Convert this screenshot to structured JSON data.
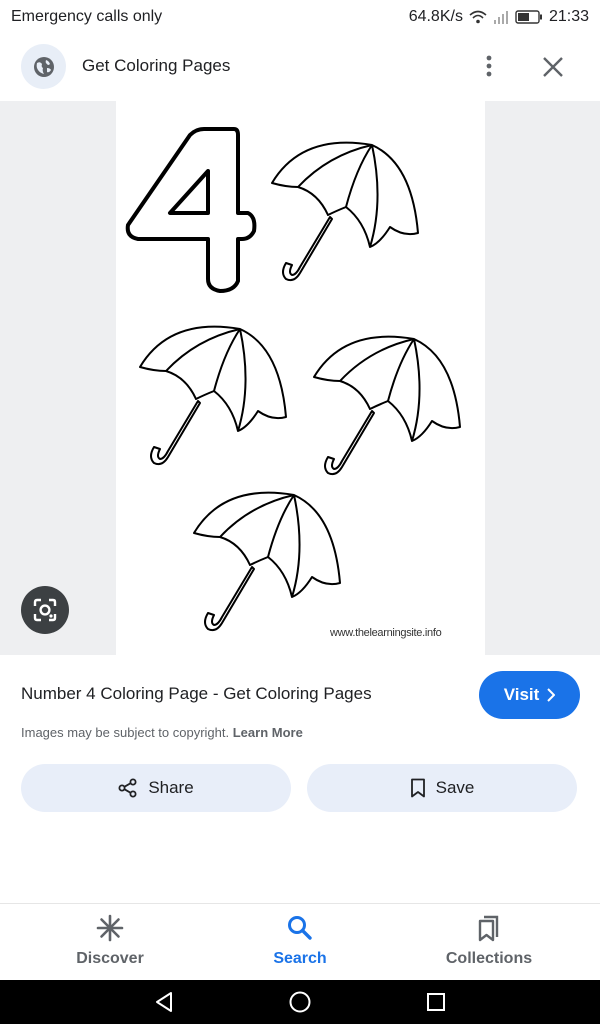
{
  "status_bar": {
    "carrier_text": "Emergency calls only",
    "network_speed": "64.8K/s",
    "time": "21:33",
    "icons": [
      "wifi-icon",
      "signal-icon",
      "battery-icon"
    ]
  },
  "top_bar": {
    "site_icon": "globe-icon",
    "title": "Get Coloring Pages",
    "menu_icon": "more-vert-icon",
    "close_icon": "close-icon"
  },
  "image": {
    "watermark": "www.thelearningsite.info",
    "lens_icon": "google-lens-icon"
  },
  "result": {
    "title": "Number 4 Coloring Page - Get Coloring Pages",
    "visit_label": "Visit",
    "copyright_text": "Images may be subject to copyright.",
    "learn_more": "Learn More"
  },
  "actions": {
    "share_label": "Share",
    "save_label": "Save"
  },
  "bottom_nav": {
    "items": [
      {
        "label": "Discover",
        "icon": "discover-asterisk-icon"
      },
      {
        "label": "Search",
        "icon": "search-icon",
        "active": true
      },
      {
        "label": "Collections",
        "icon": "collections-icon"
      }
    ]
  },
  "colors": {
    "accent": "#1a73e8",
    "pill_bg": "#e8eef9",
    "image_bg": "#eeeff1"
  }
}
